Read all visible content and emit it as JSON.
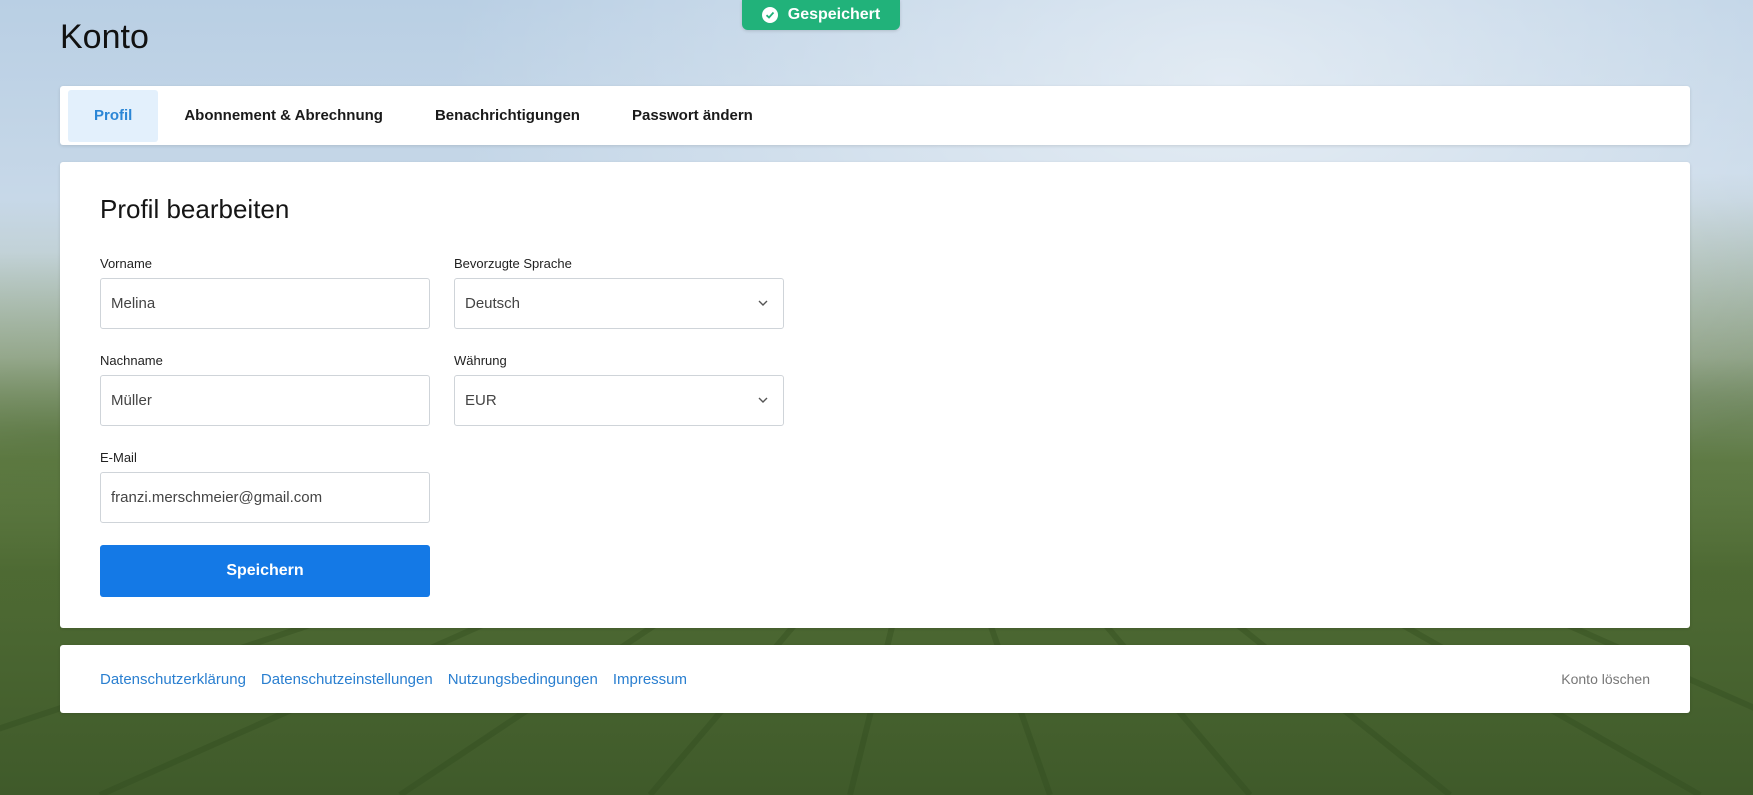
{
  "toast": {
    "text": "Gespeichert",
    "icon": "check-circle-icon",
    "color": "#21b27a"
  },
  "page": {
    "title": "Konto"
  },
  "tabs": [
    {
      "label": "Profil",
      "active": true
    },
    {
      "label": "Abonnement & Abrechnung",
      "active": false
    },
    {
      "label": "Benachrichtigungen",
      "active": false
    },
    {
      "label": "Passwort ändern",
      "active": false
    }
  ],
  "profile": {
    "heading": "Profil bearbeiten",
    "firstname": {
      "label": "Vorname",
      "value": "Melina"
    },
    "lastname": {
      "label": "Nachname",
      "value": "Müller"
    },
    "email": {
      "label": "E-Mail",
      "value": "franzi.merschmeier@gmail.com"
    },
    "language": {
      "label": "Bevorzugte Sprache",
      "value": "Deutsch"
    },
    "currency": {
      "label": "Währung",
      "value": "EUR"
    },
    "save_label": "Speichern"
  },
  "footer": {
    "links": [
      "Datenschutzerklärung",
      "Datenschutzeinstellungen",
      "Nutzungsbedingungen",
      "Impressum"
    ],
    "delete_label": "Konto löschen"
  },
  "colors": {
    "primary": "#1479e6",
    "link": "#2a7fd0",
    "tab_active_bg": "#e3f0fc"
  }
}
